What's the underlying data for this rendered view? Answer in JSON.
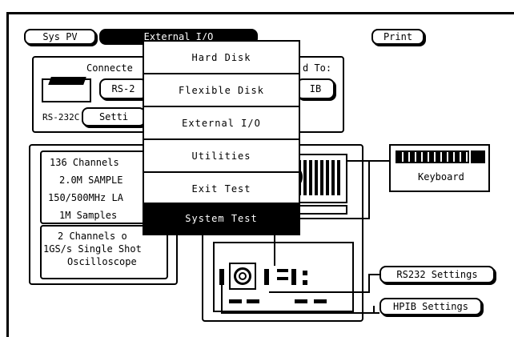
{
  "top_buttons": {
    "sys_pv": "Sys PV",
    "external_io": "External I/O",
    "print": "Print"
  },
  "connection": {
    "connected_label": "Connecte",
    "rs2_button": "RS-2",
    "connected_to_label": "d To:",
    "ib_button": "IB",
    "rs232c_label": "RS-232C",
    "settings_button": "Setti"
  },
  "system_info": {
    "lines": [
      "136 Channels",
      "2.0M SAMPLE",
      "150/500MHz LA",
      "1M Samples"
    ],
    "scope_lines": [
      "2 Channels o",
      "1GS/s Single Shot",
      "Oscilloscope"
    ]
  },
  "menu": {
    "items": [
      {
        "label": "Hard Disk",
        "selected": false
      },
      {
        "label": "Flexible Disk",
        "selected": false
      },
      {
        "label": "External I/O",
        "selected": false
      },
      {
        "label": "Utilities",
        "selected": false
      },
      {
        "label": "Exit Test",
        "selected": false
      },
      {
        "label": "System Test",
        "selected": true
      }
    ]
  },
  "right_buttons": {
    "keyboard": "Keyboard",
    "rs232_settings": "RS232 Settings",
    "hpib_settings": "HPIB Settings"
  }
}
